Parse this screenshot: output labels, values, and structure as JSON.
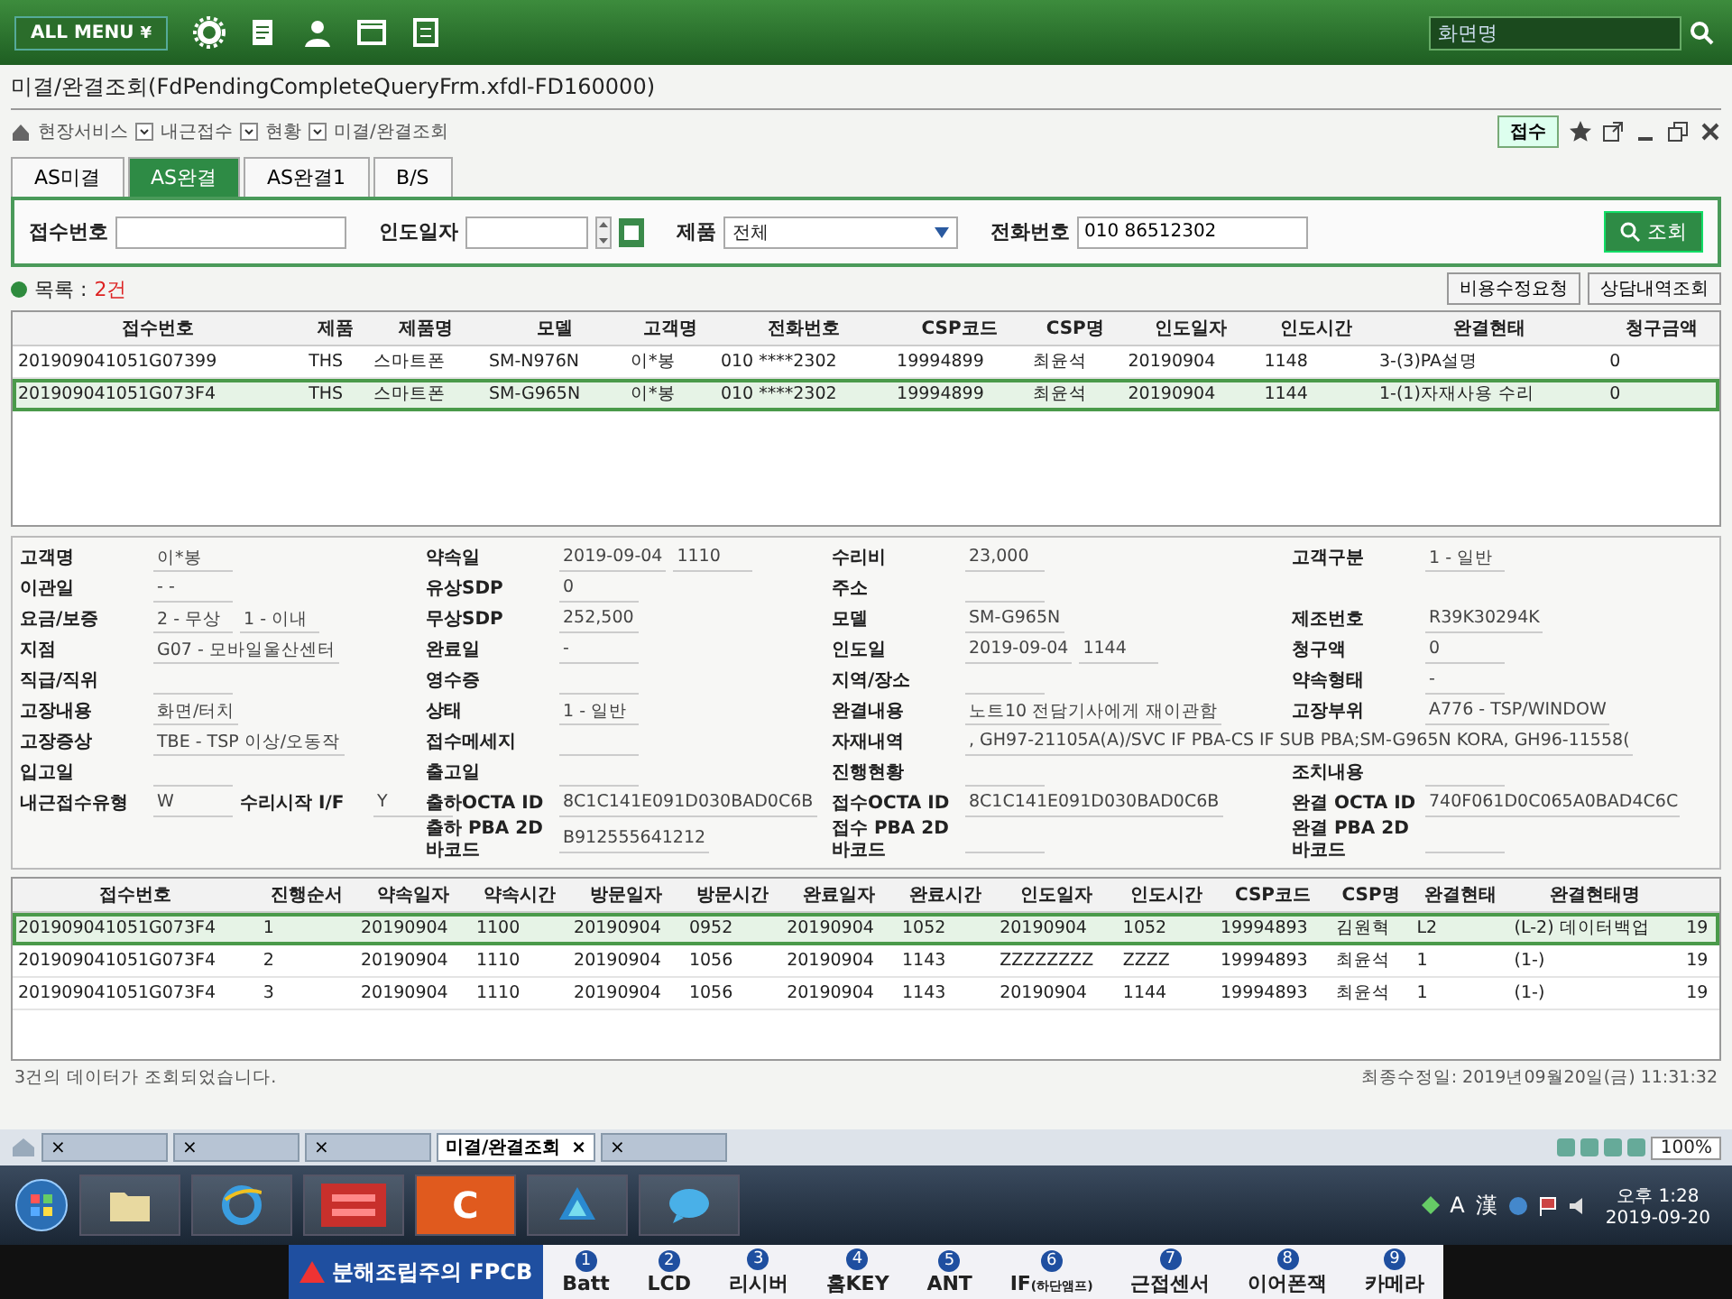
{
  "top_bar": {
    "menu_label": "ALL MENU",
    "menu_caret": "¥",
    "search_placeholder": "화면명"
  },
  "window": {
    "title": "미결/완결조회(FdPendingCompleteQueryFrm.xfdl-FD160000)",
    "breadcrumb": [
      "현장서비스",
      "내근접수",
      "현황",
      "미결/완결조회"
    ],
    "receipt_button": "접수"
  },
  "tabs": [
    {
      "label": "AS미결",
      "selected": false
    },
    {
      "label": "AS완결",
      "selected": true
    },
    {
      "label": "AS완결1",
      "selected": false
    },
    {
      "label": "B/S",
      "selected": false
    }
  ],
  "search": {
    "fields": [
      {
        "kind": "text",
        "label": "접수번호"
      },
      {
        "kind": "date",
        "label": "인도일자"
      },
      {
        "kind": "select",
        "label": "제품",
        "value": "전체"
      },
      {
        "kind": "text",
        "label": "전화번호",
        "value": "010 86512302"
      }
    ],
    "button": "조회"
  },
  "list": {
    "label": "목록 :",
    "count": "2건",
    "buttons": [
      "비용수정요청",
      "상담내역조회"
    ]
  },
  "table": {
    "columns": [
      "접수번호",
      "제품",
      "제품명",
      "모델",
      "고객명",
      "전화번호",
      "CSP코드",
      "CSP명",
      "인도일자",
      "인도시간",
      "완결현태",
      "청구금액"
    ],
    "rows": [
      {
        "selected": false,
        "cells": [
          "201909041051G07399",
          "THS",
          "스마트폰",
          "SM-N976N",
          "이*봉",
          "010 ****2302",
          "19994899",
          "최윤석",
          "20190904",
          "1148",
          "3-(3)PA설명",
          "0"
        ]
      },
      {
        "selected": true,
        "cells": [
          "201909041051G073F4",
          "THS",
          "스마트폰",
          "SM-G965N",
          "이*봉",
          "010 ****2302",
          "19994899",
          "최윤석",
          "20190904",
          "1144",
          "1-(1)자재사용 수리",
          "0"
        ]
      }
    ]
  },
  "detail": {
    "rows": [
      {
        "left": [
          {
            "label": "고객명",
            "values": [
              "이*봉"
            ]
          }
        ],
        "mid": [
          {
            "label": "약속일",
            "values": [
              "2019-09-04",
              "1110"
            ]
          }
        ],
        "right": [
          {
            "label": "수리비",
            "values": [
              "23,000"
            ]
          }
        ],
        "far": [
          {
            "label": "고객구분",
            "values": [
              "1 - 일반"
            ]
          }
        ]
      },
      {
        "left": [
          {
            "label": "이관일",
            "values": [
              "-  -"
            ]
          }
        ],
        "mid": [
          {
            "label": "유상SDP",
            "values": [
              "0"
            ]
          }
        ],
        "right": [
          {
            "label": "주소"
          }
        ]
      },
      {
        "left": [
          {
            "label": "요금/보증",
            "values": [
              "2 - 무상",
              "1 - 이내"
            ]
          }
        ],
        "mid": [
          {
            "label": "무상SDP",
            "values": [
              "252,500"
            ]
          }
        ],
        "right": [
          {
            "label": "모델",
            "values": [
              "SM-G965N"
            ]
          }
        ],
        "far": [
          {
            "label": "제조번호",
            "values": [
              "R39K30294K"
            ]
          }
        ]
      },
      {
        "left": [
          {
            "label": "지점",
            "values": [
              "G07 - 모바일울산센터"
            ]
          }
        ],
        "mid": [
          {
            "label": "완료일",
            "values": [
              "-"
            ]
          }
        ],
        "right": [
          {
            "label": "인도일",
            "values": [
              "2019-09-04",
              "1144"
            ]
          }
        ],
        "far": [
          {
            "label": "청구액",
            "values": [
              "0"
            ]
          }
        ]
      },
      {
        "left": [
          {
            "label": "직급/직위"
          }
        ],
        "mid": [
          {
            "label": "영수증"
          }
        ],
        "right": [
          {
            "label": "지역/장소"
          }
        ],
        "far": [
          {
            "label": "약속형태",
            "values": [
              "-"
            ]
          }
        ]
      },
      {
        "left": [
          {
            "label": "고장내용",
            "values": [
              "화면/터치"
            ]
          }
        ],
        "mid": [
          {
            "label": "상태",
            "values": [
              "1 - 일반"
            ]
          }
        ],
        "right": [
          {
            "label": "완결내용",
            "values": [
              "노트10 전담기사에게 재이관함"
            ]
          }
        ],
        "far": [
          {
            "label": "고장부위",
            "values": [
              "A776 - TSP/WINDOW"
            ]
          }
        ]
      },
      {
        "left": [
          {
            "label": "고장증상",
            "values": [
              "TBE - TSP 이상/오동작"
            ]
          }
        ],
        "mid": [
          {
            "label": "접수메세지"
          }
        ],
        "right": [
          {
            "label": "자재내역",
            "values": [
              ", GH97-21105A(A)/SVC IF PBA-CS IF SUB PBA;SM-G965N KORA, GH96-11558("
            ]
          }
        ]
      },
      {
        "left": [
          {
            "label": "입고일"
          }
        ],
        "mid": [
          {
            "label": "출고일"
          }
        ],
        "right": [
          {
            "label": "진행현황"
          }
        ],
        "far": [
          {
            "label": "조치내용"
          }
        ]
      },
      {
        "left": [
          {
            "label": "내근접수유형",
            "values": [
              "W"
            ]
          },
          {
            "label": "수리시작 I/F",
            "values": [
              "Y"
            ]
          }
        ],
        "mid": [
          {
            "label": "출하OCTA ID",
            "values": [
              "8C1C141E091D030BAD0C6B"
            ]
          }
        ],
        "right": [
          {
            "label": "접수OCTA ID",
            "values": [
              "8C1C141E091D030BAD0C6B"
            ]
          }
        ],
        "far": [
          {
            "label": "완결 OCTA ID",
            "values": [
              "740F061D0C065A0BAD4C6C"
            ]
          }
        ]
      },
      {
        "mid": [
          {
            "label": "출하 PBA 2D 바코드",
            "values": [
              "B912555641212"
            ]
          }
        ],
        "right": [
          {
            "label": "접수 PBA 2D 바코드"
          }
        ],
        "far": [
          {
            "label": "완결 PBA 2D 바코드"
          }
        ]
      }
    ]
  },
  "history": {
    "columns": [
      "접수번호",
      "진행순서",
      "약속일자",
      "약속시간",
      "방문일자",
      "방문시간",
      "완료일자",
      "완료시간",
      "인도일자",
      "인도시간",
      "CSP코드",
      "CSP명",
      "완결현태",
      "완결현태명"
    ],
    "rows": [
      {
        "selected": true,
        "cells": [
          "201909041051G073F4",
          "1",
          "20190904",
          "1100",
          "20190904",
          "0952",
          "20190904",
          "1052",
          "20190904",
          "1052",
          "19994893",
          "김원혁",
          "L2",
          "(L-2) 데이터백업",
          "19"
        ]
      },
      {
        "selected": false,
        "cells": [
          "201909041051G073F4",
          "2",
          "20190904",
          "1110",
          "20190904",
          "1056",
          "20190904",
          "1143",
          "ZZZZZZZZ",
          "ZZZZ",
          "19994893",
          "최윤석",
          "1",
          "(1-)",
          "19"
        ]
      },
      {
        "selected": false,
        "cells": [
          "201909041051G073F4",
          "3",
          "20190904",
          "1110",
          "20190904",
          "1056",
          "20190904",
          "1143",
          "20190904",
          "1144",
          "19994893",
          "최윤석",
          "1",
          "(1-)",
          "19"
        ]
      }
    ]
  },
  "status": {
    "message": "3건의 데이터가 조회되었습니다.",
    "modified": "최종수정일: 2019년09월20일(금) 11:31:32"
  },
  "window_tabs": [
    {
      "selected": false,
      "close": "×"
    },
    {
      "selected": false,
      "close": "×"
    },
    {
      "selected": false,
      "close": "×"
    },
    {
      "label": "미결/완결조회",
      "selected": true,
      "close": "×"
    },
    {
      "selected": false,
      "close": "×"
    }
  ],
  "zoom": "100%",
  "taskbar": {
    "apps": [
      {
        "kind": "folder"
      },
      {
        "kind": "browser"
      },
      {
        "kind": "red"
      },
      {
        "kind": "letter",
        "glyph": "C"
      },
      {
        "kind": "blue"
      },
      {
        "kind": "chat"
      }
    ],
    "ime": [
      "A",
      "漢"
    ],
    "time": "오후 1:28",
    "date": "2019-09-20"
  },
  "sticker": {
    "title": "분해조립주의 FPCB",
    "items": [
      {
        "num": "1",
        "label": "Batt"
      },
      {
        "num": "2",
        "label": "LCD"
      },
      {
        "num": "3",
        "label": "리시버"
      },
      {
        "num": "4",
        "label": "홈KEY"
      },
      {
        "num": "5",
        "label": "ANT"
      },
      {
        "num": "6",
        "label": "IF",
        "note": "(하단앰프)"
      },
      {
        "num": "7",
        "label": "근접센서"
      },
      {
        "num": "8",
        "label": "이어폰잭"
      },
      {
        "num": "9",
        "label": "카메라"
      }
    ]
  }
}
